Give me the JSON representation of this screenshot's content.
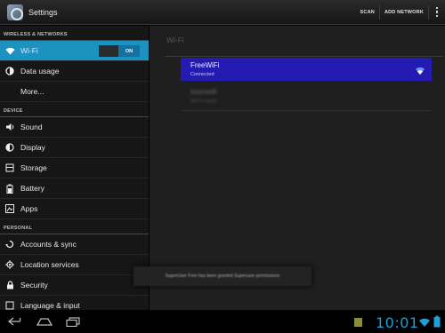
{
  "actionbar": {
    "title": "Settings",
    "scan_label": "SCAN",
    "add_network_label": "ADD NETWORK",
    "overflow_icon": "overflow-menu-icon",
    "app_icon": "settings-app-icon"
  },
  "sidebar": {
    "sections": [
      {
        "header": "WIRELESS & NETWORKS",
        "items": [
          {
            "label": "Wi-Fi",
            "icon": "wifi-icon",
            "selected": true,
            "toggle": "ON"
          },
          {
            "label": "Data usage",
            "icon": "data-usage-icon"
          },
          {
            "label": "More...",
            "icon": ""
          }
        ]
      },
      {
        "header": "DEVICE",
        "items": [
          {
            "label": "Sound",
            "icon": "sound-icon"
          },
          {
            "label": "Display",
            "icon": "display-icon"
          },
          {
            "label": "Storage",
            "icon": "storage-icon"
          },
          {
            "label": "Battery",
            "icon": "battery-icon"
          },
          {
            "label": "Apps",
            "icon": "apps-icon"
          }
        ]
      },
      {
        "header": "PERSONAL",
        "items": [
          {
            "label": "Accounts & sync",
            "icon": "sync-icon"
          },
          {
            "label": "Location services",
            "icon": "location-icon"
          },
          {
            "label": "Security",
            "icon": "lock-icon"
          },
          {
            "label": "Language & input",
            "icon": "language-icon"
          }
        ]
      }
    ]
  },
  "wifi_panel": {
    "title": "Wi-Fi",
    "networks": [
      {
        "ssid": "FreeWiFi",
        "status": "Connected",
        "signal_icon": "wifi-signal-icon"
      },
      {
        "ssid": "toomwifi",
        "status": "Not in range"
      }
    ]
  },
  "toast": {
    "text": "SuperUser Free has been granted Superuser permissions"
  },
  "systembar": {
    "time": "10:01",
    "back_icon": "back-icon",
    "home_icon": "home-icon",
    "recents_icon": "recent-apps-icon",
    "clock_color": "#1f9fd8"
  },
  "colors": {
    "selection": "#1c92c0",
    "connected_network": "#241bb3",
    "toggle_on": "#1471a0"
  }
}
